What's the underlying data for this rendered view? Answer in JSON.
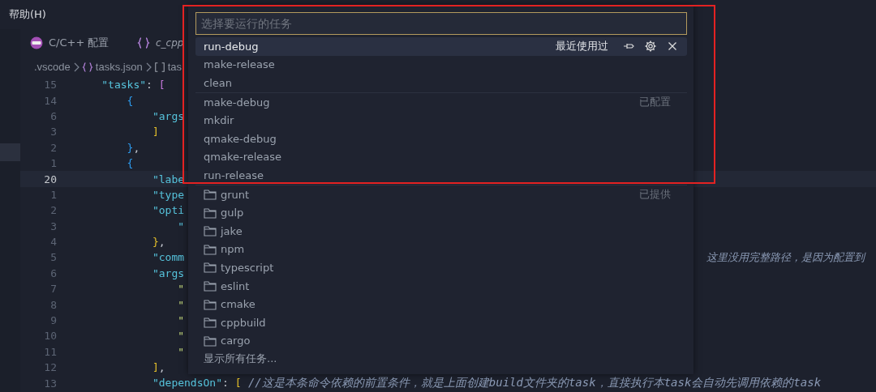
{
  "menu_bar": {
    "items": [
      {
        "label": "帮助(H)"
      }
    ]
  },
  "tabs": [
    {
      "label": "C/C++ 配置",
      "kind": "config",
      "italic": false
    },
    {
      "label": "c_cpp",
      "kind": "json",
      "italic": true
    }
  ],
  "breadcrumb": [
    {
      "label": ".vscode",
      "kind": "folder"
    },
    {
      "label": "tasks.json",
      "kind": "json"
    },
    {
      "label": "tas",
      "kind": "array"
    }
  ],
  "editor": {
    "lines": [
      {
        "number": "15",
        "current": false,
        "segments": [
          {
            "text": "    \"tasks\"",
            "kind": "key"
          },
          {
            "text": ": ",
            "kind": "punct"
          },
          {
            "text": "[",
            "kind": "bracket2"
          }
        ]
      },
      {
        "number": "14",
        "current": false,
        "segments": [
          {
            "text": "        {",
            "kind": "bracket3"
          }
        ]
      },
      {
        "number": "6",
        "current": false,
        "segments": [
          {
            "text": "            \"args",
            "kind": "key"
          }
        ]
      },
      {
        "number": "3",
        "current": false,
        "segments": [
          {
            "text": "            ]",
            "kind": "bracket1"
          }
        ]
      },
      {
        "number": "2",
        "current": false,
        "segments": [
          {
            "text": "        }",
            "kind": "bracket3"
          },
          {
            "text": ",",
            "kind": "punct"
          }
        ]
      },
      {
        "number": "1",
        "current": false,
        "segments": [
          {
            "text": "        {",
            "kind": "bracket3"
          }
        ]
      },
      {
        "number": "20",
        "current": true,
        "segments": [
          {
            "text": "            \"labe",
            "kind": "key"
          }
        ]
      },
      {
        "number": "1",
        "current": false,
        "segments": [
          {
            "text": "            \"type",
            "kind": "key"
          }
        ]
      },
      {
        "number": "2",
        "current": false,
        "segments": [
          {
            "text": "            \"opti",
            "kind": "key"
          }
        ]
      },
      {
        "number": "3",
        "current": false,
        "segments": [
          {
            "text": "                \"",
            "kind": "key"
          }
        ]
      },
      {
        "number": "4",
        "current": false,
        "segments": [
          {
            "text": "            }",
            "kind": "bracket1"
          },
          {
            "text": ",",
            "kind": "punct"
          }
        ]
      },
      {
        "number": "5",
        "current": false,
        "segments": [
          {
            "text": "            \"comm",
            "kind": "key"
          }
        ],
        "trailing_comment": "这里没用完整路径，是因为配置到"
      },
      {
        "number": "6",
        "current": false,
        "segments": [
          {
            "text": "            \"args",
            "kind": "key"
          }
        ]
      },
      {
        "number": "7",
        "current": false,
        "segments": [
          {
            "text": "                \"",
            "kind": "string"
          }
        ]
      },
      {
        "number": "8",
        "current": false,
        "segments": [
          {
            "text": "                \"",
            "kind": "string"
          }
        ]
      },
      {
        "number": "9",
        "current": false,
        "segments": [
          {
            "text": "                \"",
            "kind": "string"
          }
        ]
      },
      {
        "number": "10",
        "current": false,
        "segments": [
          {
            "text": "                \"",
            "kind": "string"
          }
        ]
      },
      {
        "number": "11",
        "current": false,
        "segments": [
          {
            "text": "                \"",
            "kind": "string"
          }
        ]
      },
      {
        "number": "12",
        "current": false,
        "segments": [
          {
            "text": "            ]",
            "kind": "bracket1"
          },
          {
            "text": ",",
            "kind": "punct"
          }
        ]
      },
      {
        "number": "13",
        "current": false,
        "segments": [
          {
            "text": "            \"dependsOn\"",
            "kind": "key"
          },
          {
            "text": ": ",
            "kind": "punct"
          },
          {
            "text": "[",
            "kind": "bracket1"
          },
          {
            "text": " //这是本条命令依赖的前置条件，就是上面创建build文件夹的task，直接执行本task会自动先调用依赖的task",
            "kind": "comment"
          }
        ]
      }
    ]
  },
  "quick_pick": {
    "placeholder": "选择要运行的任务",
    "groups": [
      {
        "label": "最近使用过",
        "items": [
          {
            "label": "run-debug",
            "kind": "task",
            "selected": true
          },
          {
            "label": "make-release",
            "kind": "task",
            "selected": false
          },
          {
            "label": "clean",
            "kind": "task",
            "selected": false
          }
        ]
      },
      {
        "label": "已配置",
        "items": [
          {
            "label": "make-debug",
            "kind": "task",
            "selected": false
          },
          {
            "label": "mkdir",
            "kind": "task",
            "selected": false
          },
          {
            "label": "qmake-debug",
            "kind": "task",
            "selected": false
          },
          {
            "label": "qmake-release",
            "kind": "task",
            "selected": false
          },
          {
            "label": "run-release",
            "kind": "task",
            "selected": false
          }
        ]
      },
      {
        "label": "已提供",
        "items": [
          {
            "label": "grunt",
            "kind": "folder",
            "selected": false
          },
          {
            "label": "gulp",
            "kind": "folder",
            "selected": false
          },
          {
            "label": "jake",
            "kind": "folder",
            "selected": false
          },
          {
            "label": "npm",
            "kind": "folder",
            "selected": false
          },
          {
            "label": "typescript",
            "kind": "folder",
            "selected": false
          },
          {
            "label": "eslint",
            "kind": "folder",
            "selected": false
          },
          {
            "label": "cmake",
            "kind": "folder",
            "selected": false
          },
          {
            "label": "cppbuild",
            "kind": "folder",
            "selected": false
          },
          {
            "label": "cargo",
            "kind": "folder",
            "selected": false
          }
        ]
      }
    ],
    "footer": "显示所有任务..."
  }
}
